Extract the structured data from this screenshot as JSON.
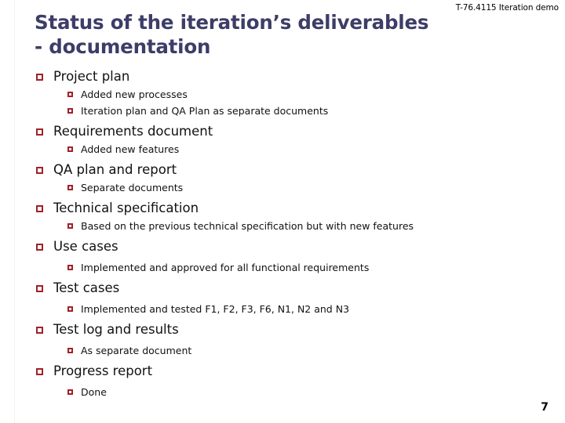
{
  "slide": {
    "course_tag": "T-76.4115 Iteration demo",
    "title_lines": [
      "Status of the iteration’s deliverables",
      "- documentation"
    ],
    "page_number": "7",
    "colors": {
      "title": "#3d3d68",
      "bullet": "#a02128",
      "text": "#111111",
      "background": "#ffffff"
    },
    "bullet_icon": "hollow-square-bullet",
    "items": [
      {
        "label": "Project plan",
        "subitems": [
          "Added new processes",
          "Iteration plan and QA Plan as separate documents"
        ]
      },
      {
        "label": "Requirements document",
        "subitems": [
          "Added new features"
        ]
      },
      {
        "label": "QA plan and report",
        "subitems": [
          "Separate documents"
        ]
      },
      {
        "label": "Technical specification",
        "subitems": [
          "Based on the previous technical specification but with new features"
        ]
      },
      {
        "label": "Use cases",
        "subitems": [
          "Implemented and approved for all functional requirements"
        ]
      },
      {
        "label": "Test cases",
        "subitems": [
          "Implemented and tested F1, F2, F3, F6, N1, N2 and N3"
        ]
      },
      {
        "label": "Test log and results",
        "subitems": [
          "As separate document"
        ]
      },
      {
        "label": "Progress report",
        "subitems": [
          "Done"
        ]
      }
    ]
  }
}
